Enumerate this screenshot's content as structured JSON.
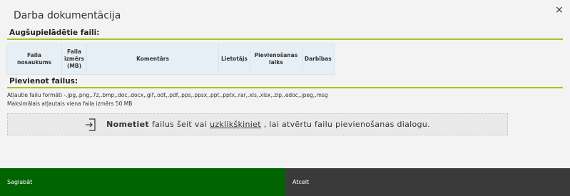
{
  "dialog": {
    "title": "Darba dokumentācija",
    "close_symbol": "×"
  },
  "uploaded": {
    "heading": "Augšupielādētie faili:",
    "columns": [
      {
        "line1": "Faila nosaukums",
        "line2": "",
        "line3": ""
      },
      {
        "line1": "Faila",
        "line2": "izmērs",
        "line3": "(MB)"
      },
      {
        "line1": "Komentārs",
        "line2": "",
        "line3": ""
      },
      {
        "line1": "Lietotājs",
        "line2": "",
        "line3": ""
      },
      {
        "line1": "Pievienošanas",
        "line2": "laiks",
        "line3": ""
      },
      {
        "line1": "Darbības",
        "line2": "",
        "line3": ""
      }
    ]
  },
  "add": {
    "heading": "Pievienot failus:",
    "formats_text": "Atļautie failu formāti -.jpg,.png,.7z,.bmp,.doc,.docx,.gif,.odt,.pdf,.pps,.ppsx,.ppt,.pptx,.rar,.xls,.xlsx,.zip,.edoc,.jpeg,.msg",
    "max_size_text": "Maksimālais atļautais viena faila izmērs 50 MB",
    "dropzone": {
      "bold": "Nometiet",
      "text1": "failus šeit vai",
      "link": "uzklikšķiniet",
      "text2": ", lai atvērtu failu pievienošanas dialogu.",
      "icon": "file-import-icon"
    }
  },
  "footer": {
    "save_label": "Saglabāt",
    "cancel_label": "Atcelt",
    "save_color": "#006400",
    "cancel_color": "#3a3a3a"
  },
  "colors": {
    "accent_rule": "#a3c41f",
    "table_header_bg": "#e6eff5"
  }
}
